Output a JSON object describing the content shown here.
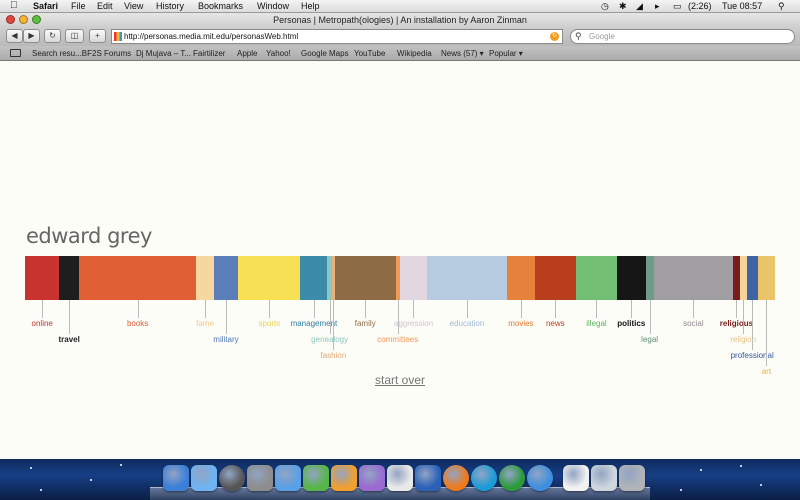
{
  "menubar": {
    "app": "Safari",
    "items": [
      "File",
      "Edit",
      "View",
      "History",
      "Bookmarks",
      "Window",
      "Help"
    ],
    "battery": "(2:26)",
    "clock": "Tue 08:57"
  },
  "window": {
    "title": "Personas | Metropath(ologies) | An installation by Aaron Zinman"
  },
  "toolbar": {
    "back_label": "◀",
    "forward_label": "▶",
    "reload_label": "↻",
    "new_tab_label": "+",
    "url": "http://personas.media.mit.edu/personasWeb.html",
    "search_placeholder": "Google"
  },
  "bookmarks": [
    "Search resu...BF2S Forums",
    "Dj Mujava – T...",
    "Fairtilizer",
    "Apple",
    "Yahoo!",
    "Google Maps",
    "YouTube",
    "Wikipedia",
    "News (57) ▾",
    "Popular ▾"
  ],
  "persona": {
    "name": "edward grey",
    "start_over": "start over"
  },
  "segments": [
    {
      "label": "online",
      "share": 0.046,
      "color": "#c8322f",
      "label_color": "#c8322f",
      "row": 0,
      "bold": false
    },
    {
      "label": "travel",
      "share": 0.026,
      "color": "#1e1e1e",
      "label_color": "#222222",
      "row": 1,
      "bold": true
    },
    {
      "label": "books",
      "share": 0.157,
      "color": "#e05f35",
      "label_color": "#e05f35",
      "row": 0,
      "bold": false
    },
    {
      "label": "fame",
      "share": 0.023,
      "color": "#f6d7a0",
      "label_color": "#f0c890",
      "row": 0,
      "bold": false
    },
    {
      "label": "military",
      "share": 0.033,
      "color": "#5b7eb8",
      "label_color": "#4f77b3",
      "row": 1,
      "bold": false
    },
    {
      "label": "sports",
      "share": 0.083,
      "color": "#f8e055",
      "label_color": "#f2d24a",
      "row": 0,
      "bold": false
    },
    {
      "label": "management",
      "share": 0.036,
      "color": "#3d8bab",
      "label_color": "#2f7fa3",
      "row": 0,
      "bold": false
    },
    {
      "label": "genealogy",
      "share": 0.006,
      "color": "#8ac9c0",
      "label_color": "#8ac6bd",
      "row": 1,
      "bold": false
    },
    {
      "label": "fashion",
      "share": 0.004,
      "color": "#e8b17d",
      "label_color": "#e3a878",
      "row": 2,
      "bold": false
    },
    {
      "label": "family",
      "share": 0.081,
      "color": "#8d6b45",
      "label_color": "#8d6b45",
      "row": 0,
      "bold": false
    },
    {
      "label": "committees",
      "share": 0.006,
      "color": "#f29a58",
      "label_color": "#ee9a5c",
      "row": 1,
      "bold": false
    },
    {
      "label": "aggression",
      "share": 0.036,
      "color": "#e2d6e0",
      "label_color": "#cfc4cf",
      "row": 0,
      "bold": false
    },
    {
      "label": "education",
      "share": 0.107,
      "color": "#b6cbe0",
      "label_color": "#9fbad6",
      "row": 0,
      "bold": false
    },
    {
      "label": "movies",
      "share": 0.037,
      "color": "#e5833e",
      "label_color": "#e07a35",
      "row": 0,
      "bold": false
    },
    {
      "label": "news",
      "share": 0.055,
      "color": "#b83e1d",
      "label_color": "#b83e1d",
      "row": 0,
      "bold": false
    },
    {
      "label": "illegal",
      "share": 0.055,
      "color": "#72be72",
      "label_color": "#5fb35f",
      "row": 0,
      "bold": false
    },
    {
      "label": "politics",
      "share": 0.038,
      "color": "#161616",
      "label_color": "#111111",
      "row": 0,
      "bold": true
    },
    {
      "label": "legal",
      "share": 0.011,
      "color": "#6f9c85",
      "label_color": "#5d8f77",
      "row": 1,
      "bold": false
    },
    {
      "label": "social",
      "share": 0.106,
      "color": "#a19ea3",
      "label_color": "#8e8a90",
      "row": 0,
      "bold": false
    },
    {
      "label": "religious",
      "share": 0.009,
      "color": "#781c1c",
      "label_color": "#781c1c",
      "row": 0,
      "bold": true
    },
    {
      "label": "religion",
      "share": 0.009,
      "color": "#f2d49a",
      "label_color": "#e6c283",
      "row": 1,
      "bold": false
    },
    {
      "label": "professional",
      "share": 0.015,
      "color": "#3e64a3",
      "label_color": "#3357a0",
      "row": 2,
      "bold": false
    },
    {
      "label": "art",
      "share": 0.023,
      "color": "#ebc36a",
      "label_color": "#e0b253",
      "row": 3,
      "bold": false
    }
  ],
  "dock": {
    "icons": [
      "finder-icon",
      "itunes-icon",
      "time-machine-icon",
      "photo-booth-icon",
      "ichat-icon",
      "green-app-icon",
      "preview-icon",
      "purple-app-icon",
      "calendar-icon",
      "word-icon",
      "firefox-icon",
      "skype-icon",
      "spotify-icon",
      "safari-icon",
      "document-icon",
      "folder-icon",
      "trash-icon"
    ],
    "colors": [
      "#3b7fd8",
      "#6fb3f2",
      "#555",
      "#8d8d8d",
      "#5aa0e6",
      "#58b54a",
      "#f0a030",
      "#9a6ad0",
      "#e9e9e9",
      "#2b62b8",
      "#f07a1a",
      "#1a9bd8",
      "#2a9a3a",
      "#3c8fe0",
      "#f2f2f2",
      "#cfd6de",
      "#b0b4b8"
    ]
  }
}
